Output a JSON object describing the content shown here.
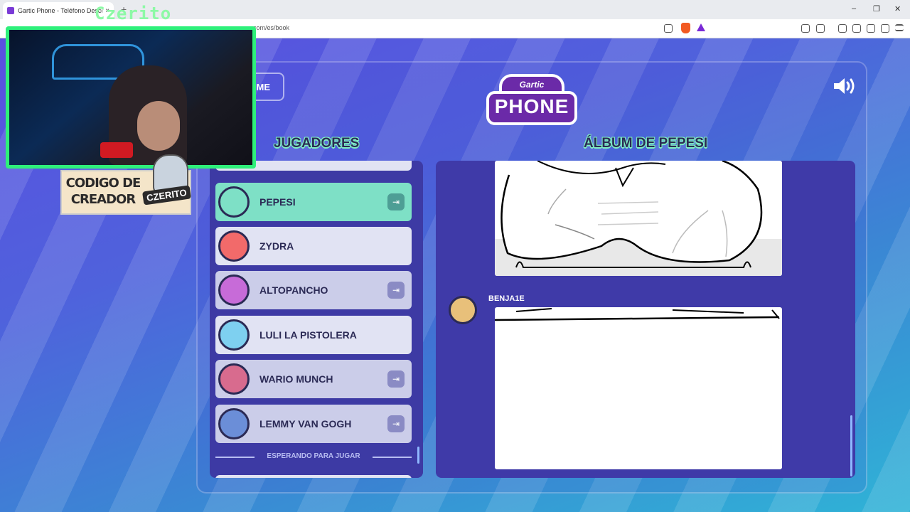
{
  "browser": {
    "tab_title": "Gartic Phone - Teléfono Descor",
    "tab_close": "×",
    "new_tab": "+",
    "url": "com/es/book",
    "window_controls": {
      "minimize": "–",
      "restore": "❐",
      "close": "✕"
    }
  },
  "overlay": {
    "streamer_name": "Czerito",
    "creator_code_label": "CODIGO DE CREADOR",
    "creator_code": "CZERITO"
  },
  "header": {
    "home_label": "OME",
    "logo_top": "Gartic",
    "logo_main": "PHONE"
  },
  "players": {
    "title": "JUGADORES",
    "items": [
      {
        "name": "PEPESI",
        "state": "active",
        "exit": true,
        "color": "#7ee0c6"
      },
      {
        "name": "ZYDRA",
        "state": "light",
        "exit": false,
        "color": "#f26a6a"
      },
      {
        "name": "ALTOPANCHO",
        "state": "normal",
        "exit": true,
        "color": "#c76bd8"
      },
      {
        "name": "LULI LA PISTOLERA",
        "state": "light",
        "exit": false,
        "color": "#7ed0f0"
      },
      {
        "name": "WARIO MUNCH",
        "state": "normal",
        "exit": true,
        "color": "#d86b8e"
      },
      {
        "name": "LEMMY VAN GOGH",
        "state": "normal",
        "exit": true,
        "color": "#6b8ed8"
      }
    ],
    "waiting_label": "ESPERANDO PARA JUGAR"
  },
  "album": {
    "title": "ÁLBUM DE PEPESI",
    "entries": [
      {
        "author": "BENJA1E"
      }
    ]
  }
}
